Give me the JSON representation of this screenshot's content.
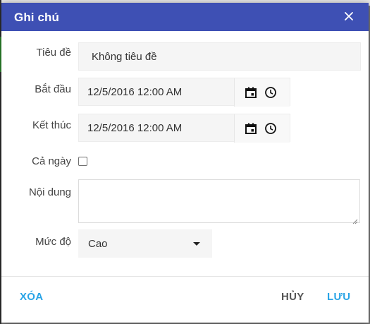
{
  "dialog": {
    "title": "Ghi chú",
    "close_icon": "close-icon"
  },
  "form": {
    "title_label": "Tiêu đề",
    "title_value": "Không tiêu đề",
    "start_label": "Bắt đầu",
    "start_value": "12/5/2016 12:00 AM",
    "end_label": "Kết thúc",
    "end_value": "12/5/2016 12:00 AM",
    "all_day_label": "Cả ngày",
    "all_day_checked": false,
    "content_label": "Nội dung",
    "content_value": "",
    "priority_label": "Mức độ",
    "priority_value": "Cao"
  },
  "footer": {
    "delete_label": "XÓA",
    "cancel_label": "HỦY",
    "save_label": "LƯU"
  },
  "colors": {
    "header_bg": "#3e50b4",
    "accent": "#29a4e6",
    "cancel_text": "#555555"
  }
}
